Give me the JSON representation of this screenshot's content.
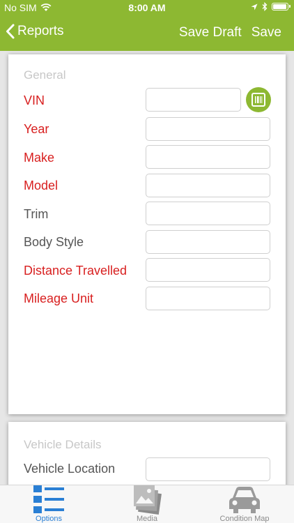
{
  "status_bar": {
    "carrier": "No SIM",
    "time": "8:00 AM",
    "battery_level": 0.95
  },
  "nav": {
    "back_label": "Reports",
    "save_draft_label": "Save Draft",
    "save_label": "Save"
  },
  "general": {
    "section_title": "General",
    "vin_label": "VIN",
    "year_label": "Year",
    "make_label": "Make",
    "model_label": "Model",
    "trim_label": "Trim",
    "body_style_label": "Body Style",
    "distance_travelled_label": "Distance Travelled",
    "mileage_unit_label": "Mileage Unit"
  },
  "vehicle_details": {
    "section_title": "Vehicle Details",
    "vehicle_location_label": "Vehicle Location"
  },
  "tabs": [
    {
      "label": "Options",
      "icon": "options-list-icon",
      "active": true
    },
    {
      "label": "Media",
      "icon": "photo-stack-icon",
      "active": false
    },
    {
      "label": "Condition Map",
      "icon": "car-icon",
      "active": false
    }
  ],
  "colors": {
    "brand": "#8db832",
    "required": "#d81f1f",
    "active_tab": "#2a7fd4"
  }
}
